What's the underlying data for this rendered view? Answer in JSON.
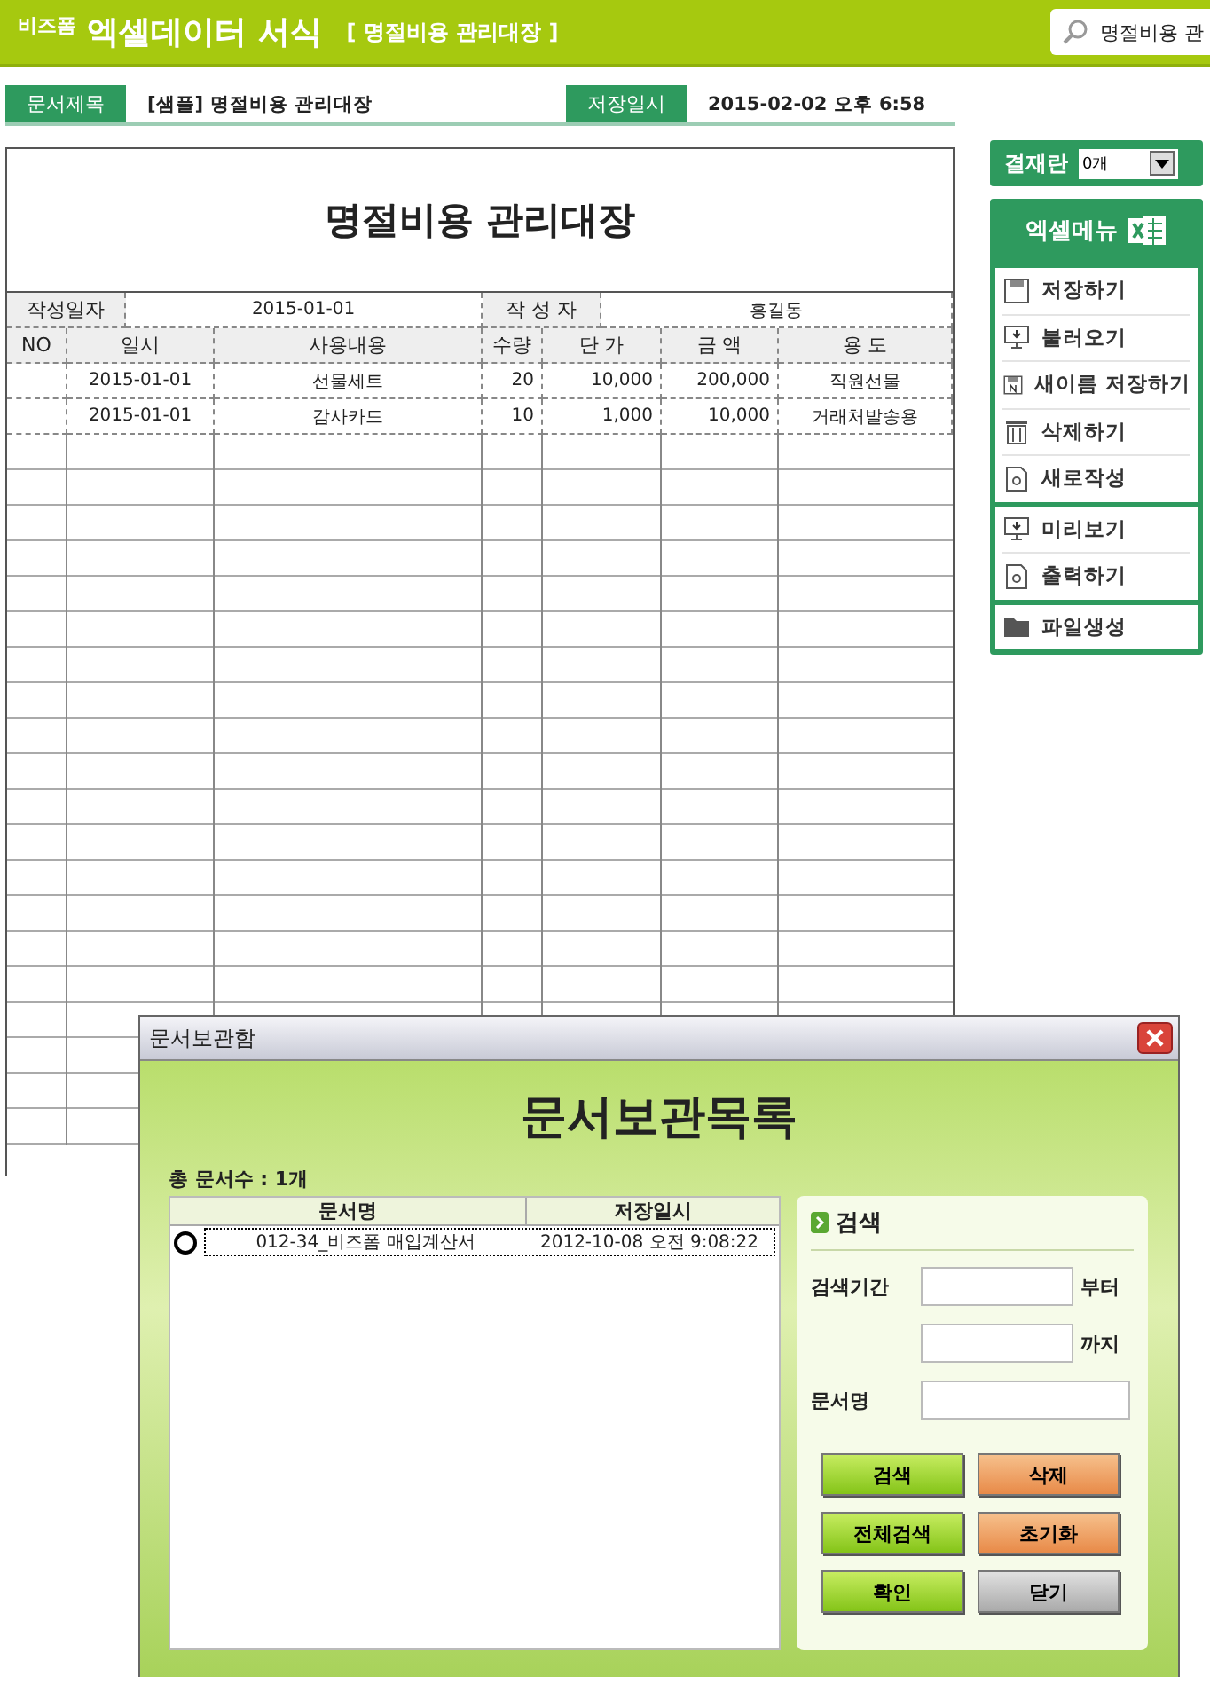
{
  "header": {
    "brand": "비즈폼",
    "title": "엑셀데이터 서식",
    "subtitle": "[ 명절비용 관리대장 ]",
    "search_value": "명절비용 관"
  },
  "info": {
    "doc_label": "문서제목",
    "doc_title": "[샘플] 명절비용 관리대장",
    "saved_label": "저장일시",
    "saved_value": "2015-02-02  오후 6:58"
  },
  "sheet": {
    "title": "명절비용 관리대장",
    "date_label": "작성일자",
    "date": "2015-01-01",
    "author_label": "작 성 자",
    "author": "홍길동",
    "columns": [
      "NO",
      "일시",
      "사용내용",
      "수량",
      "단  가",
      "금  액",
      "용  도"
    ],
    "rows": [
      [
        "",
        "2015-01-01",
        "선물세트",
        "20",
        "10,000",
        "200,000",
        "직원선물"
      ],
      [
        "",
        "2015-01-01",
        "감사카드",
        "10",
        "1,000",
        "10,000",
        "거래처발송용"
      ]
    ]
  },
  "sidebar": {
    "approval_label": "결재란",
    "approval_value": "0개",
    "menu_title": "엑셀메뉴",
    "groups": [
      [
        "저장하기",
        "불러오기",
        "새이름 저장하기",
        "삭제하기",
        "새로작성"
      ],
      [
        "미리보기",
        "출력하기"
      ],
      [
        "파일생성"
      ]
    ]
  },
  "dialog": {
    "title": "문서보관함",
    "heading": "문서보관목록",
    "count": "총 문서수 : 1개",
    "columns": [
      "문서명",
      "저장일시"
    ],
    "rows": [
      {
        "name": "012-34_비즈폼 매입계산서",
        "date": "2012-10-08 오전 9:08:22",
        "selected": false
      }
    ],
    "search": {
      "title": "검색",
      "period_label": "검색기간",
      "from": "부터",
      "to": "까지",
      "name_label": "문서명"
    },
    "buttons": [
      {
        "label": "검색",
        "kind": "green"
      },
      {
        "label": "삭제",
        "kind": "orange"
      },
      {
        "label": "전체검색",
        "kind": "green"
      },
      {
        "label": "초기화",
        "kind": "orange"
      },
      {
        "label": "확인",
        "kind": "green"
      },
      {
        "label": "닫기",
        "kind": "gray"
      }
    ]
  }
}
